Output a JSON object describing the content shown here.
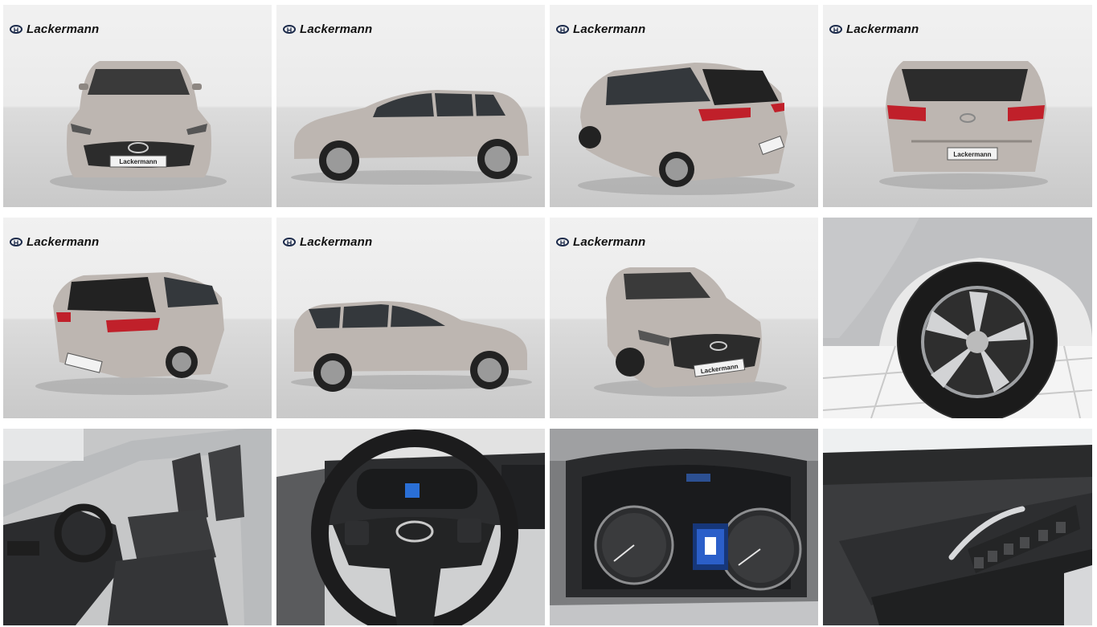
{
  "gallery": {
    "logo_text": "Lackermann",
    "plate_text": "Lackermann",
    "tiles": [
      {
        "view": "front",
        "icon": "car-front-photo"
      },
      {
        "view": "side-left",
        "icon": "car-side-photo"
      },
      {
        "view": "rear-three-quarter-left",
        "icon": "car-rear-photo"
      },
      {
        "view": "rear",
        "icon": "car-rear-photo"
      },
      {
        "view": "rear-three-quarter-right",
        "icon": "car-rear-photo"
      },
      {
        "view": "side-right",
        "icon": "car-side-photo"
      },
      {
        "view": "front-three-quarter",
        "icon": "car-front-photo"
      },
      {
        "view": "wheel",
        "icon": "wheel-photo"
      },
      {
        "view": "interior-seats",
        "icon": "interior-photo"
      },
      {
        "view": "steering-wheel",
        "icon": "steering-wheel-photo"
      },
      {
        "view": "instrument-cluster",
        "icon": "gauge-photo"
      },
      {
        "view": "door-panel",
        "icon": "door-photo"
      }
    ]
  },
  "colors": {
    "car_body": "#bdb6b1",
    "logo_blue": "#1b2a4a",
    "studio_light": "#eeeeee",
    "floor": "#cfcfcf"
  }
}
